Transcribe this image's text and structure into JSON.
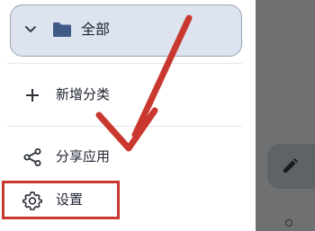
{
  "drawer": {
    "category": {
      "label": "全部",
      "icons": [
        "chevron-down-icon",
        "folder-icon"
      ],
      "colors": {
        "background": "#dde4f0",
        "border": "#9aa4b4",
        "folder": "#3f5a86"
      }
    },
    "items": [
      {
        "label": "新增分类",
        "icon": "plus-icon"
      },
      {
        "label": "分享应用",
        "icon": "share-icon"
      },
      {
        "label": "设置",
        "icon": "gear-icon"
      }
    ]
  },
  "annotation": {
    "highlight_target": "设置",
    "colors": {
      "arrow": "#c9382f",
      "box": "#c9382f"
    }
  },
  "background": {
    "fab_icon": "pencil-icon",
    "colors": {
      "scrim": "#6f7072",
      "fab": "#5f6267"
    }
  }
}
